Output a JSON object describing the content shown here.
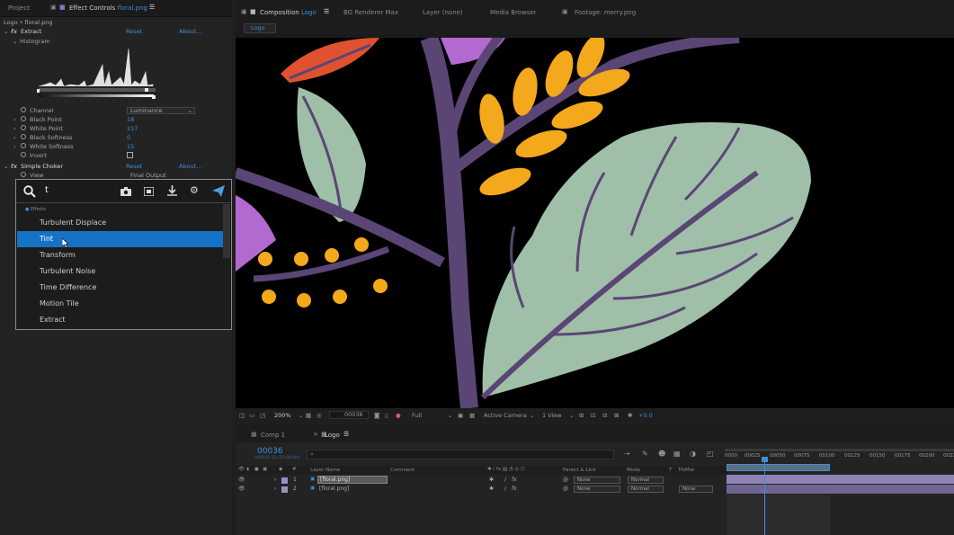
{
  "left_panel": {
    "tab_project": "Project",
    "tab_effect_controls_prefix": "Effect Controls",
    "tab_effect_controls_file": "floral.png",
    "breadcrumb": "Logo • floral.png",
    "extract": {
      "name": "Extract",
      "reset": "Reset",
      "about": "About..."
    },
    "histogram_label": "Histogram",
    "properties": [
      {
        "label": "Channel",
        "value": "Luminance",
        "type": "dropdown"
      },
      {
        "label": "Black Point",
        "value": "18"
      },
      {
        "label": "White Point",
        "value": "217"
      },
      {
        "label": "Black Softness",
        "value": "0"
      },
      {
        "label": "White Softness",
        "value": "15"
      },
      {
        "label": "Invert",
        "value": "",
        "type": "checkbox"
      }
    ],
    "choker": {
      "name": "Simple Choker",
      "reset": "Reset",
      "about": "About..."
    },
    "view": {
      "label": "View",
      "value": "Final Output"
    }
  },
  "popup": {
    "search_text": "t",
    "group_label": "Effects",
    "items": [
      "Turbulent Displace",
      "Tint",
      "Transform",
      "Turbulent Noise",
      "Time Difference",
      "Motion Tile",
      "Extract"
    ],
    "selected_index": 1
  },
  "viewer": {
    "tab_comp_prefix": "Composition",
    "tab_comp_name": "Logo",
    "tab_renderer": "BG Renderer Max",
    "tab_layer": "Layer (none)",
    "tab_media": "Media Browser",
    "tab_footage": "Footage: merry.png",
    "sub_tab": "Logo",
    "zoom": "200%",
    "timecode": "00036",
    "resolution": "Full",
    "camera": "Active Camera",
    "views": "1 View",
    "exposure": "+0.0"
  },
  "timeline": {
    "tab_comp1": "Comp 1",
    "tab_logo": "Logo",
    "current_time": "00036",
    "subtime": "0:00:01:11 (25.00 fps)",
    "search_placeholder": "",
    "headers": {
      "layer_name": "Layer Name",
      "comment": "Comment",
      "parent": "Parent & Link",
      "mode": "Mode",
      "t": "T",
      "trkmat": "TrkMat"
    },
    "layers": [
      {
        "num": "1",
        "name": "[floral.png]",
        "parent": "None",
        "mode": "Normal",
        "trkmat": ""
      },
      {
        "num": "2",
        "name": "[floral.png]",
        "parent": "None",
        "mode": "Normal",
        "trkmat": "None"
      }
    ],
    "ruler": [
      "0000",
      "00025",
      "00050",
      "00075",
      "00100",
      "00125",
      "00150",
      "00175",
      "00200",
      "00225"
    ]
  },
  "colors": {
    "accent": "#1672c6",
    "leaf_green": "#9fbfa8",
    "branch": "#5b4575",
    "orange": "#f4a81c",
    "red_leaf": "#e0522f",
    "purple": "#b36ad0"
  }
}
